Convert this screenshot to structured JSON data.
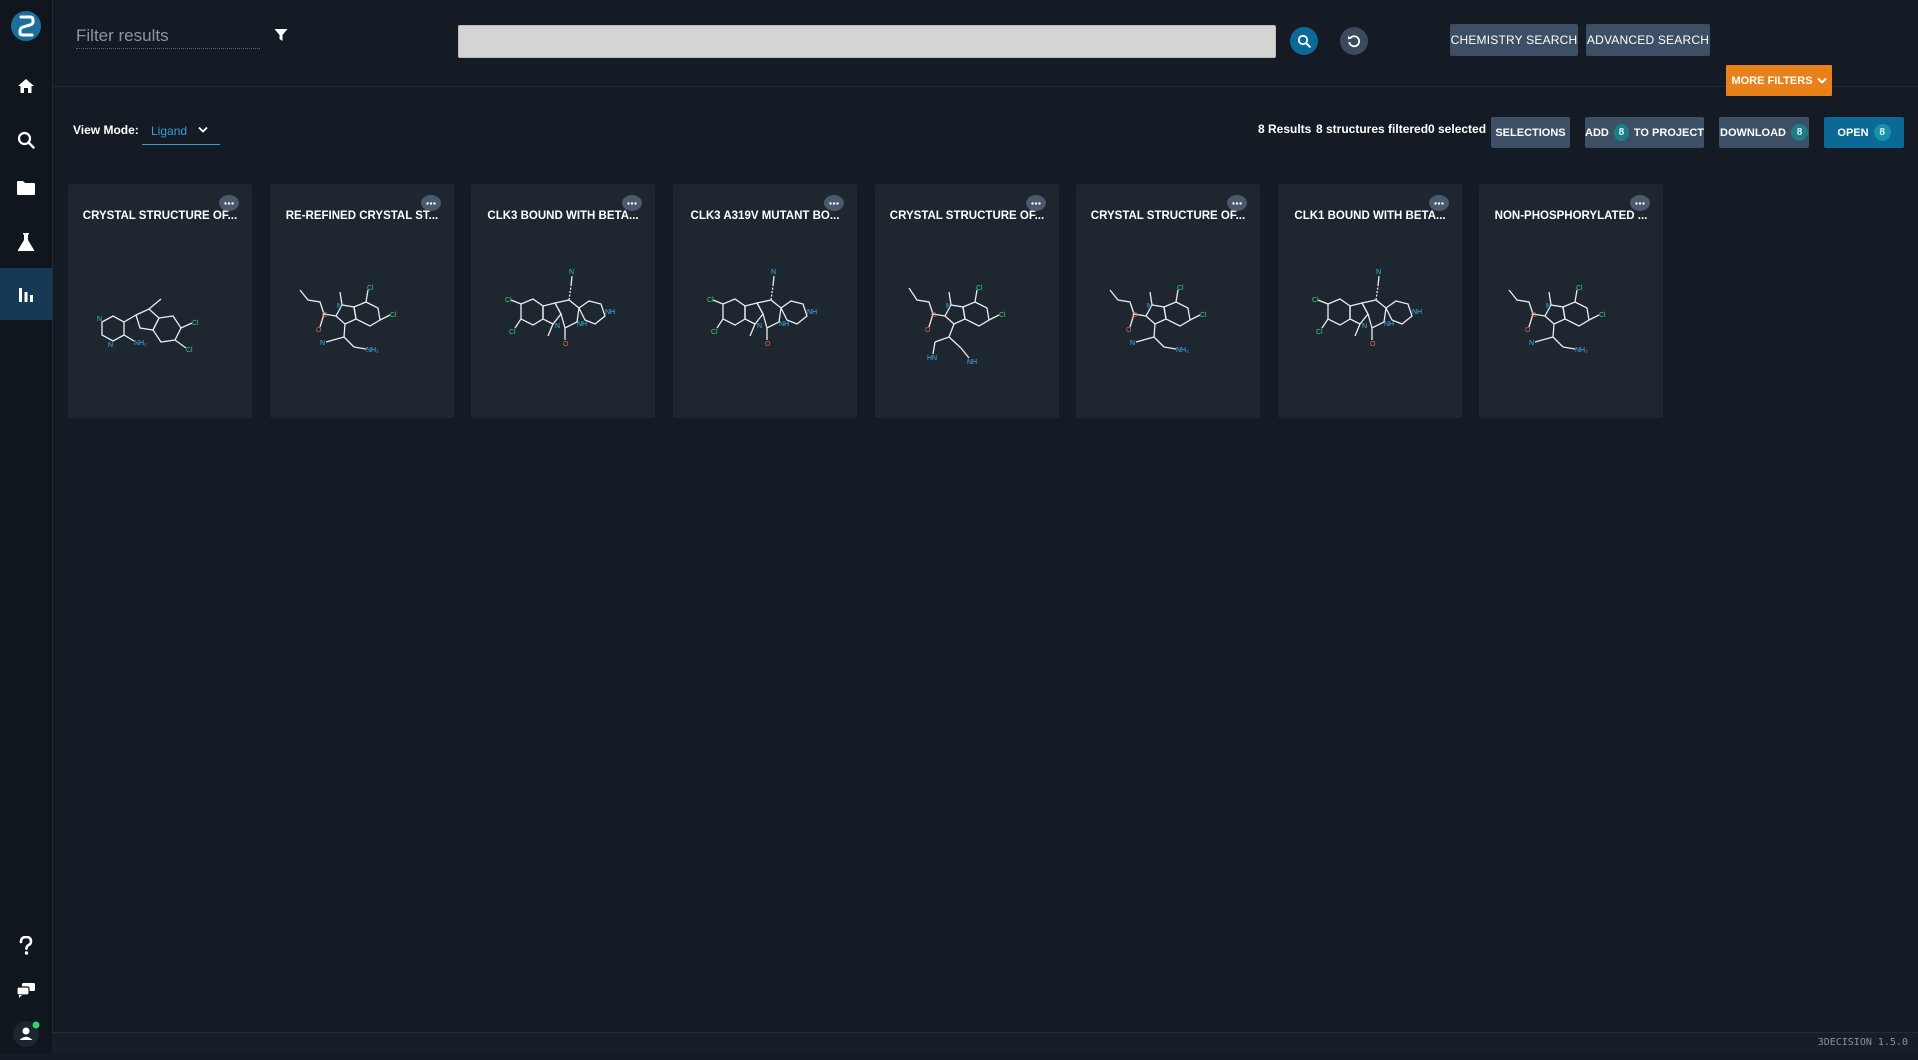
{
  "colors": {
    "background": "#141b24",
    "rail": "#0f161d",
    "accent_blue": "#2ea3d6",
    "primary_button": "#0a6a95",
    "secondary_button": "#3d4f64",
    "orange": "#e8811a",
    "card": "#1e2630",
    "atom_n": "#3fb7e8",
    "atom_cl": "#3bd16a",
    "atom_o": "#e06b3a"
  },
  "sidebar": {
    "icons": [
      "logo-icon",
      "home-icon",
      "search-icon",
      "folder-icon",
      "flask-icon",
      "bar-chart-icon",
      "help-icon",
      "chat-icon",
      "user-icon"
    ],
    "active": "bar-chart-icon"
  },
  "topbar": {
    "filter_placeholder": "Filter results",
    "search_value": "",
    "chemistry_search": "CHEMISTRY SEARCH",
    "advanced_search": "ADVANCED SEARCH",
    "more_filters": "MORE FILTERS"
  },
  "toolbar": {
    "view_mode_label": "View Mode:",
    "view_mode_value": "Ligand",
    "results": "8 Results",
    "filtered": "8 structures filtered",
    "selected": "0 selected",
    "selections": "SELECTIONS",
    "add_prefix": "ADD",
    "add_count": "8",
    "add_suffix": "TO PROJECT",
    "download": "DOWNLOAD",
    "download_count": "8",
    "open": "OPEN",
    "open_count": "8"
  },
  "cards": [
    {
      "title": "CRYSTAL STRUCTURE OF...",
      "molecule": "pyrimidinyl-indole"
    },
    {
      "title": "RE-REFINED CRYSTAL ST...",
      "molecule": "indole-ester-nitrile"
    },
    {
      "title": "CLK3 BOUND WITH BETA...",
      "molecule": "spiro-carboline"
    },
    {
      "title": "CLK3 A319V MUTANT BO...",
      "molecule": "spiro-carboline"
    },
    {
      "title": "CRYSTAL STRUCTURE OF...",
      "molecule": "indole-ester-imine"
    },
    {
      "title": "CRYSTAL STRUCTURE OF...",
      "molecule": "indole-ester-nitrile"
    },
    {
      "title": "CLK1 BOUND WITH BETA...",
      "molecule": "spiro-carboline"
    },
    {
      "title": "NON-PHOSPHORYLATED ...",
      "molecule": "indole-ester-nitrile"
    }
  ],
  "footer": {
    "version": "3DECISION 1.5.0"
  }
}
